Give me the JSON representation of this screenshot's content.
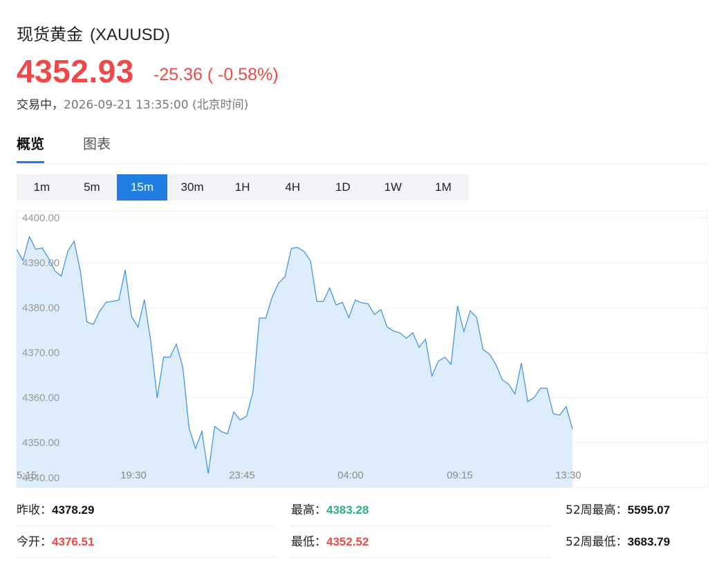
{
  "header": {
    "name": "现货黄金",
    "symbol": "(XAUUSD)",
    "price": "4352.93",
    "change": "-25.36 ( -0.58%)",
    "status_label": "交易中，",
    "timestamp": "2026-09-21 13:35:00",
    "timezone": "(北京时间)"
  },
  "tabs": [
    {
      "label": "概览",
      "active": true
    },
    {
      "label": "图表",
      "active": false
    }
  ],
  "intervals": [
    "1m",
    "5m",
    "15m",
    "30m",
    "1H",
    "4H",
    "1D",
    "1W",
    "1M"
  ],
  "active_interval": "15m",
  "colors": {
    "price_red": "#f04848",
    "up_green": "#2bb08a",
    "accent_blue": "#1f7ee0",
    "area_fill": "#deedfb",
    "line": "#3a8ee0"
  },
  "chart_data": {
    "type": "area",
    "y_ticks": [
      "4400.00",
      "4390.00",
      "4380.00",
      "4370.00",
      "4360.00",
      "4350.00",
      "4340.00"
    ],
    "ylim": [
      4340,
      4400
    ],
    "x_ticks": [
      "5:15",
      "19:30",
      "23:45",
      "04:00",
      "09:15",
      "13:30"
    ],
    "grid": true,
    "values": [
      4393,
      4390.5,
      4395.8,
      4393,
      4393.3,
      4391,
      4388.2,
      4387,
      4392.5,
      4394.8,
      4388,
      4376.8,
      4376.3,
      4379.2,
      4381.2,
      4381.4,
      4381.7,
      4388.4,
      4378,
      4375.7,
      4381.8,
      4372.5,
      4359.9,
      4369,
      4369,
      4371.9,
      4366.9,
      4353.2,
      4348.7,
      4352.5,
      4343.1,
      4353.6,
      4352.5,
      4351.9,
      4356.8,
      4355,
      4355.9,
      4361.3,
      4377.7,
      4377.7,
      4382.4,
      4385.5,
      4386.9,
      4393.2,
      4393.4,
      4392.5,
      4390.4,
      4381.4,
      4381.4,
      4384.4,
      4380.6,
      4381.2,
      4377.8,
      4381.7,
      4381.1,
      4380.9,
      4378.5,
      4379.6,
      4375.7,
      4374.8,
      4374.4,
      4373.2,
      4374.4,
      4371.2,
      4373,
      4364.8,
      4368.1,
      4369,
      4367.4,
      4380.4,
      4374.7,
      4379.3,
      4377.8,
      4370.7,
      4369.7,
      4367.4,
      4364,
      4363,
      4360.8,
      4367.7,
      4359.1,
      4360,
      4362.1,
      4362.1,
      4356.4,
      4356.1,
      4358,
      4353
    ]
  },
  "stats": [
    [
      {
        "label": "昨收：",
        "value": "4378.29",
        "tone": "black"
      },
      {
        "label": "最高：",
        "value": "4383.28",
        "tone": "green"
      },
      {
        "label": "52周最高：",
        "value": "5595.07",
        "tone": "black"
      }
    ],
    [
      {
        "label": "今开：",
        "value": "4376.51",
        "tone": "red"
      },
      {
        "label": "最低：",
        "value": "4352.52",
        "tone": "red"
      },
      {
        "label": "52周最低：",
        "value": "3683.79",
        "tone": "black"
      }
    ]
  ]
}
